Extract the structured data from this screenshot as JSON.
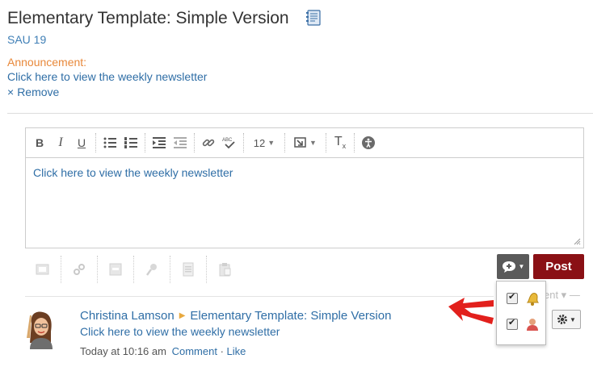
{
  "header": {
    "title": "Elementary Template: Simple Version",
    "course_code": "SAU 19"
  },
  "announcement": {
    "label": "Announcement:",
    "link_text": "Click here to view the weekly newsletter",
    "remove_label": "Remove",
    "remove_icon": "×"
  },
  "editor": {
    "toolbar": {
      "bold": "B",
      "italic": "I",
      "underline": "U",
      "font_size": "12",
      "clear_format": "T"
    },
    "content": "Click here to view the weekly newsletter"
  },
  "actions": {
    "post_label": "Post"
  },
  "feed": {
    "faded_label": "ent ▾ —",
    "post": {
      "author": "Christina Lamson",
      "target": "Elementary Template: Simple Version",
      "text": "Click here to view the weekly newsletter",
      "timestamp": "Today at 10:16 am",
      "comment_label": "Comment",
      "separator": "·",
      "like_label": "Like"
    }
  },
  "colors": {
    "post_button": "#8a1015",
    "link": "#2f6ea6",
    "announcement_label": "#e8883a",
    "arrow": "#e2201c"
  }
}
